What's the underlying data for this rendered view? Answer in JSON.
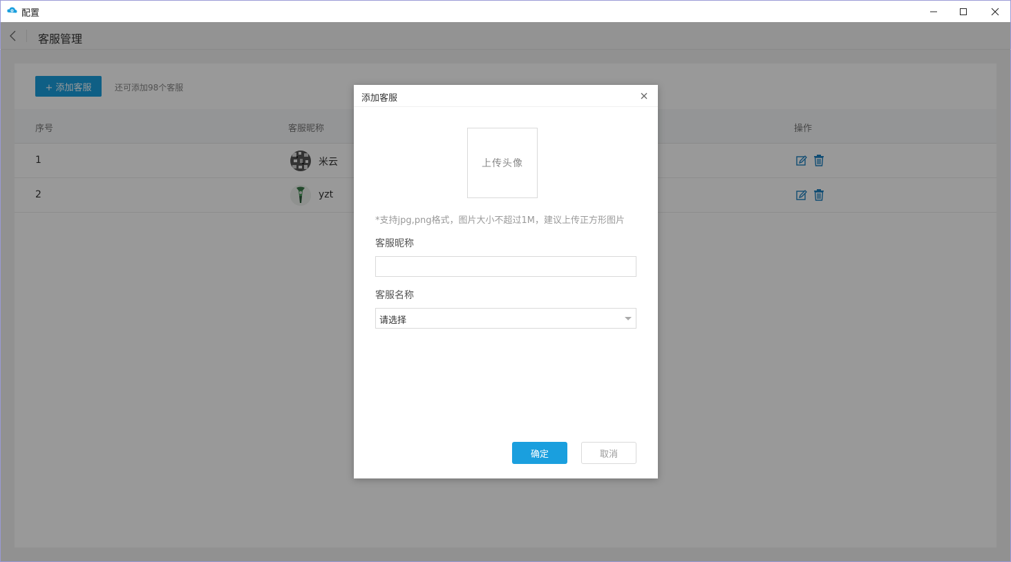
{
  "window": {
    "title": "配置",
    "icon": "cloud-eye-icon",
    "controls": [
      "minimize-icon",
      "maximize-icon",
      "close-icon"
    ]
  },
  "header": {
    "back_icon": "chevron-left-icon",
    "title": "客服管理"
  },
  "toolbar": {
    "add_button_label": "+ 添加客服",
    "quota_text": "还可添加98个客服"
  },
  "table": {
    "columns": [
      "序号",
      "客服昵称",
      "操作"
    ],
    "rows": [
      {
        "index": "1",
        "nickname": "米云",
        "avatar": "qr-pattern-avatar",
        "actions": [
          "edit-icon",
          "trash-icon"
        ]
      },
      {
        "index": "2",
        "nickname": "yzt",
        "avatar": "figure-avatar",
        "actions": [
          "edit-icon",
          "trash-icon"
        ]
      }
    ]
  },
  "modal": {
    "title": "添加客服",
    "close_icon": "close-icon",
    "upload_label": "上传头像",
    "upload_hint": "*支持jpg,png格式，图片大小不超过1M，建议上传正方形图片",
    "nickname_label": "客服昵称",
    "nickname_value": "",
    "name_label": "客服名称",
    "name_select_value": "请选择",
    "ok_label": "确定",
    "cancel_label": "取消"
  },
  "colors": {
    "accent": "#1a9fde",
    "overlay": "rgba(0,0,0,0.4)"
  }
}
